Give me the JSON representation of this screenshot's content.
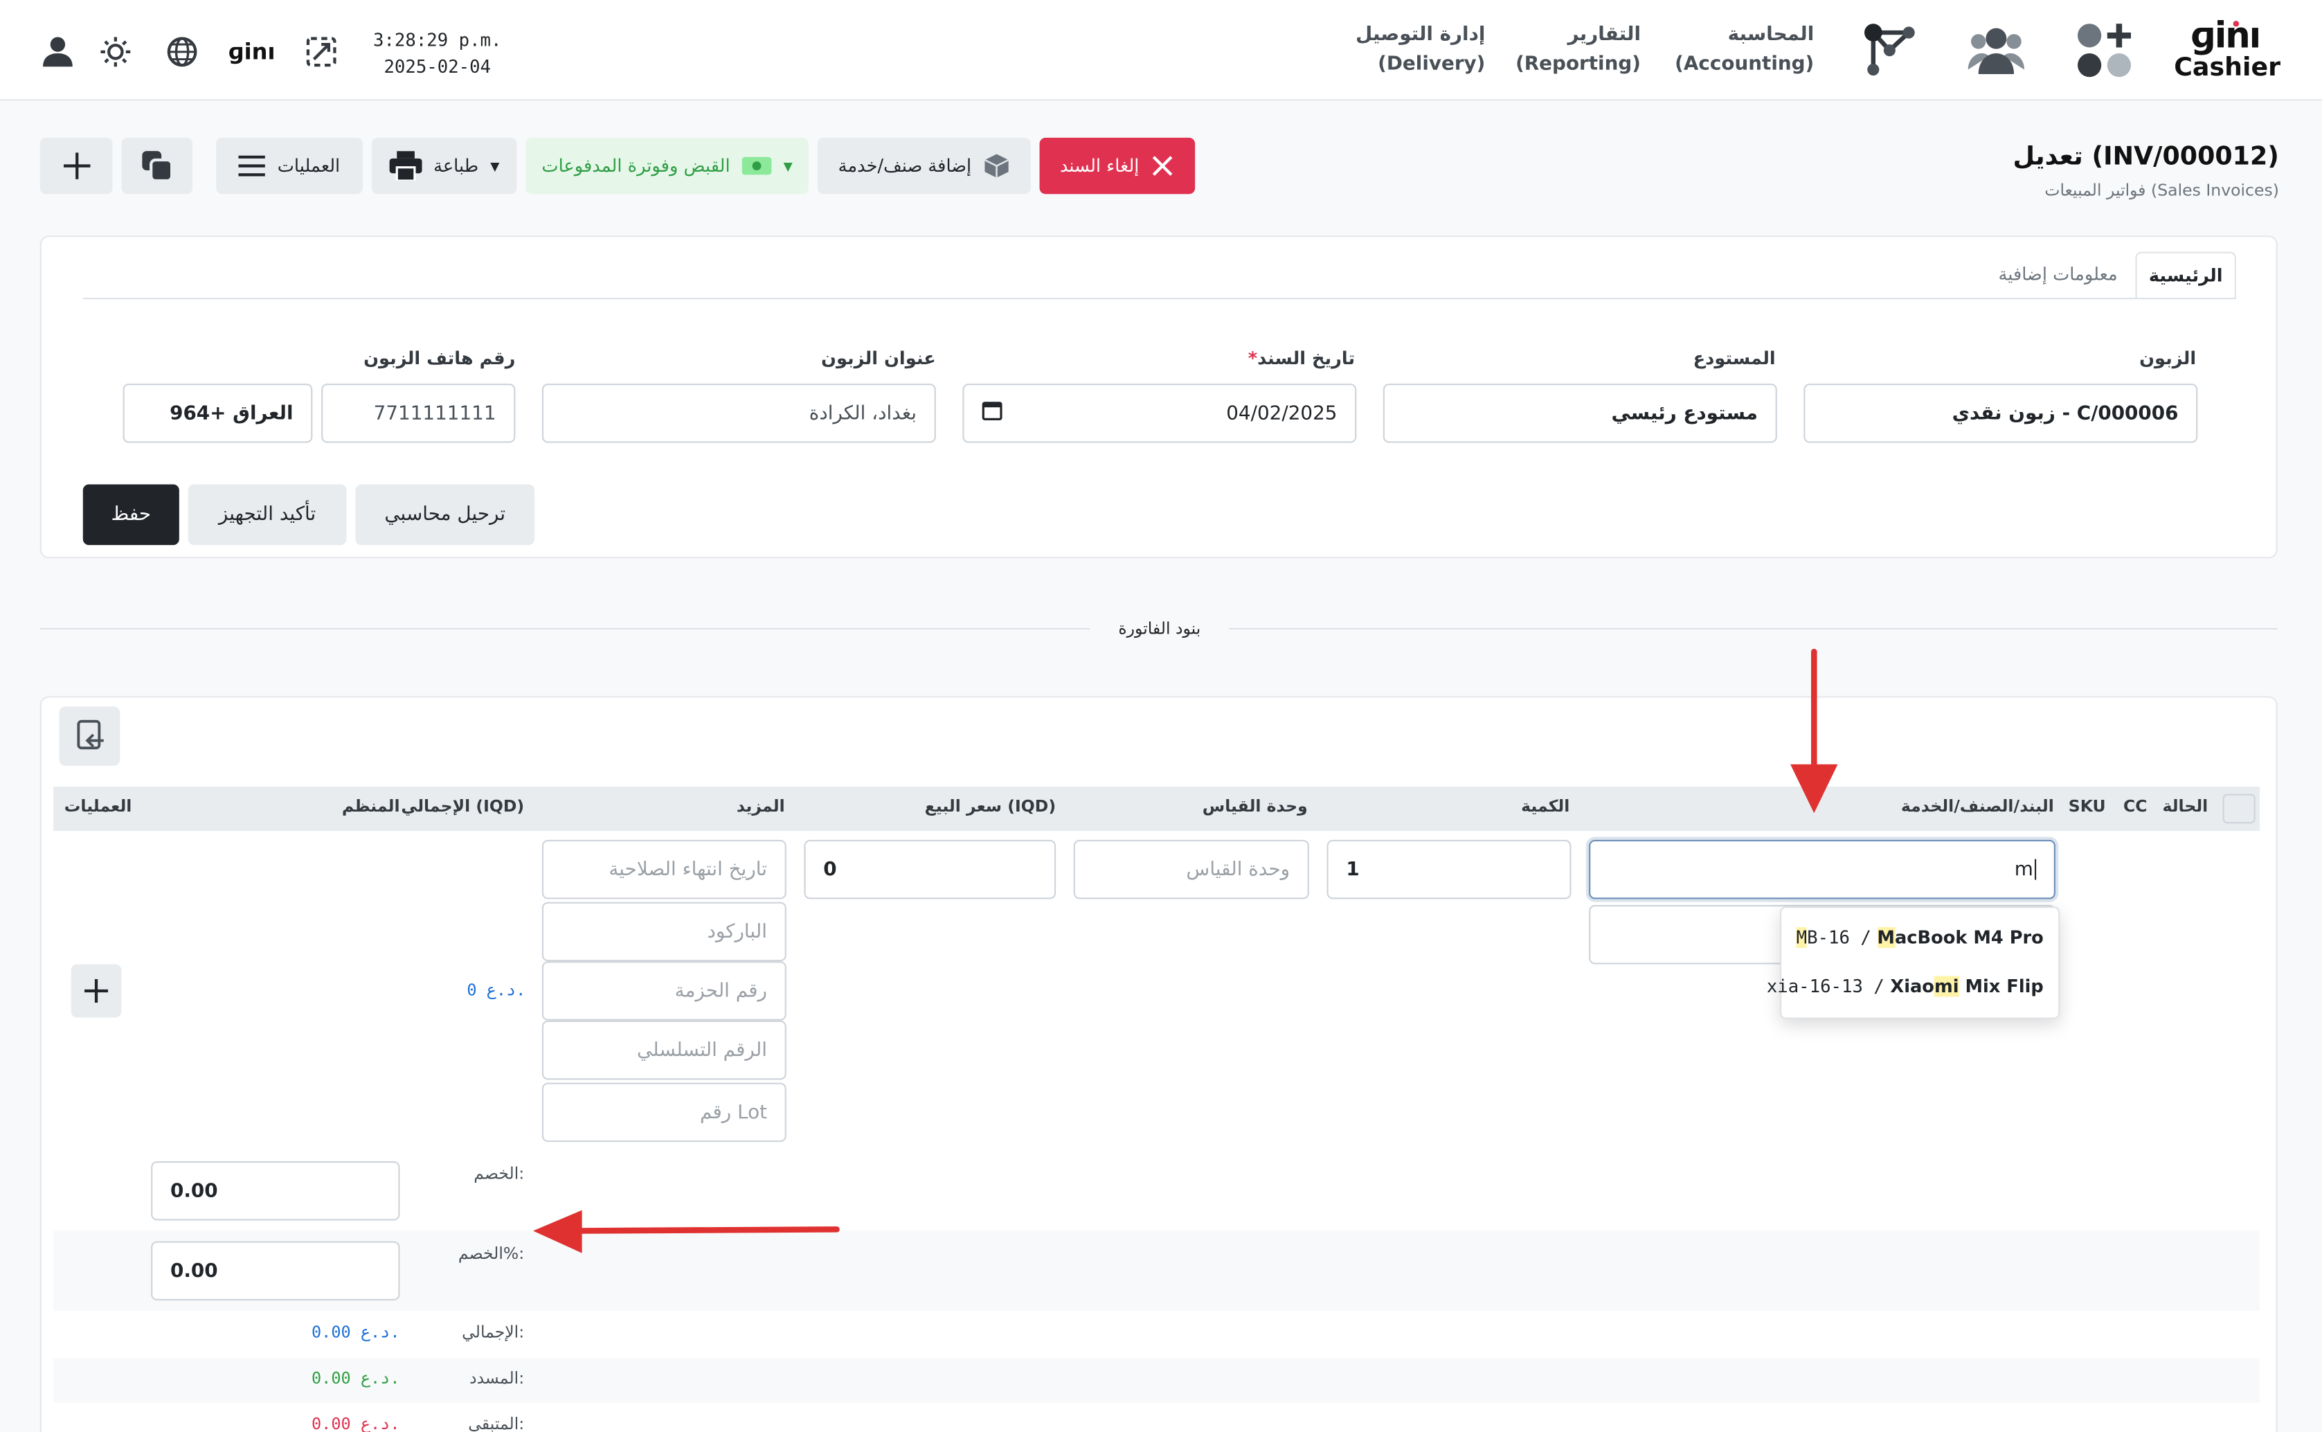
{
  "header": {
    "brand_cashier": "Cashier",
    "nav": [
      {
        "ar": "المحاسبة",
        "en": "(Accounting)"
      },
      {
        "ar": "التقارير",
        "en": "(Reporting)"
      },
      {
        "ar": "إدارة التوصيل",
        "en": "(Delivery)"
      }
    ],
    "time": "3:28:29 p.m.",
    "date": "2025-02-04"
  },
  "page": {
    "title": "تعديل (INV/000012)",
    "subtitle": "فواتير المبيعات (Sales Invoices)"
  },
  "toolbar": {
    "cancel_doc": "إلغاء السند",
    "add_item": "إضافة صنف/خدمة",
    "receipt": "القبض وفوترة المدفوعات",
    "print": "طباعة",
    "operations": "العمليات"
  },
  "tabs": {
    "main": "الرئيسية",
    "extra": "معلومات إضافية"
  },
  "form": {
    "customer_label": "الزبون",
    "customer_value": "زبون نقدي - C/000006",
    "warehouse_label": "المستودع",
    "warehouse_value": "مستودع رئيسي",
    "date_label": "تاريخ السند",
    "date_required": "*",
    "date_value": "04/02/2025",
    "address_label": "عنوان الزبون",
    "address_value": "بغداد، الكرادة",
    "phone_label": "رقم هاتف الزبون",
    "phone_value": "7711111111",
    "phone_country": "العراق +964"
  },
  "actions": {
    "post": "ترحيل محاسبي",
    "confirm": "تأكيد التجهيز",
    "save": "حفظ"
  },
  "section_title": "بنود الفاتورة",
  "table": {
    "headers": {
      "status": "الحالة",
      "cc": "CC",
      "sku": "SKU",
      "item": "البند/الصنف/الخدمة",
      "qty": "الكمية",
      "uom": "وحدة القياس",
      "price": "سعر البيع (IQD)",
      "more": "المزيد",
      "total": "الإجمالي (IQD)",
      "organizer": "المنظم",
      "ops": "العمليات"
    },
    "row": {
      "item_value": "m",
      "item_required": "*",
      "qty": "1",
      "uom_placeholder": "وحدة القياس",
      "price": "0",
      "more": [
        "تاريخ انتهاء الصلاحية",
        "الباركود",
        "رقم الحزمة",
        "الرقم التسلسلي",
        "رقم Lot"
      ],
      "total": "0 د.ع."
    },
    "dropdown": [
      {
        "code_hl": "M",
        "code_rest": "B-16 /",
        "name_hl": "M",
        "name_rest": "acBook M4 Pro"
      },
      {
        "code_hl": "",
        "code_rest": "xia-16-13 /",
        "name_pre": "Xiao",
        "name_hl": "mi",
        "name_rest": " Mix Flip"
      }
    ]
  },
  "totals": {
    "discount_label": "الخصم:",
    "discount_value": "0.00",
    "discount_pct_label": "الخصم%:",
    "discount_pct_value": "0.00",
    "total_label": "الإجمالي:",
    "total_value": "0.00 د.ع.",
    "paid_label": "المسدد:",
    "paid_value": "0.00 د.ع.",
    "remaining_label": "المتبقي:",
    "remaining_value": "0.00 د.ع."
  },
  "colors": {
    "danger": "#e03150",
    "success_bg": "#e6f7e9",
    "success_text": "#2f9e44",
    "link_blue": "#1c6fd6",
    "annotation_red": "#e03131"
  }
}
